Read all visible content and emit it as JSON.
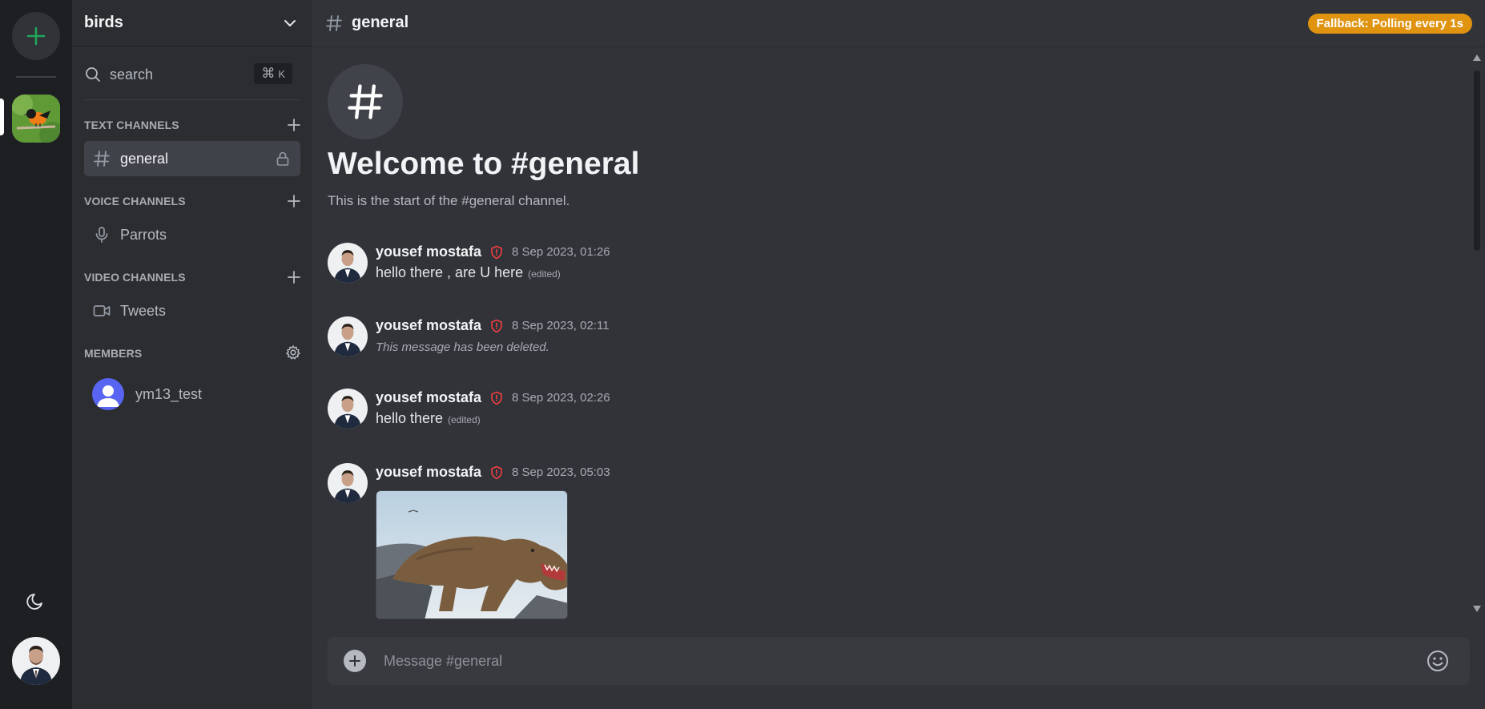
{
  "server": {
    "name": "birds"
  },
  "search": {
    "label": "search",
    "shortcut_key": "K",
    "shortcut_mod": "⌘"
  },
  "sections": {
    "text": {
      "title": "TEXT CHANNELS",
      "channels": [
        {
          "label": "general",
          "locked": true,
          "active": true
        }
      ]
    },
    "voice": {
      "title": "VOICE CHANNELS",
      "channels": [
        {
          "label": "Parrots"
        }
      ]
    },
    "video": {
      "title": "VIDEO CHANNELS",
      "channels": [
        {
          "label": "Tweets"
        }
      ]
    },
    "members": {
      "title": "MEMBERS",
      "list": [
        {
          "name": "ym13_test"
        }
      ]
    }
  },
  "header": {
    "channel": "general",
    "status_badge": "Fallback: Polling every 1s"
  },
  "welcome": {
    "title": "Welcome to #general",
    "subtitle": "This is the start of the #general channel."
  },
  "messages": [
    {
      "author": "yousef mostafa",
      "time": "8 Sep 2023, 01:26",
      "text": "hello there , are U here",
      "edited": "(edited)"
    },
    {
      "author": "yousef mostafa",
      "time": "8 Sep 2023, 02:11",
      "deleted_text": "This message has been deleted."
    },
    {
      "author": "yousef mostafa",
      "time": "8 Sep 2023, 02:26",
      "text": "hello there",
      "edited": "(edited)"
    },
    {
      "author": "yousef mostafa",
      "time": "8 Sep 2023, 05:03",
      "attachment": "image"
    }
  ],
  "composer": {
    "placeholder": "Message #general"
  },
  "colors": {
    "accent_green": "#23a55a",
    "badge": "#e0930f",
    "shield": "#f23f43",
    "member_avatar": "#5865f2"
  }
}
